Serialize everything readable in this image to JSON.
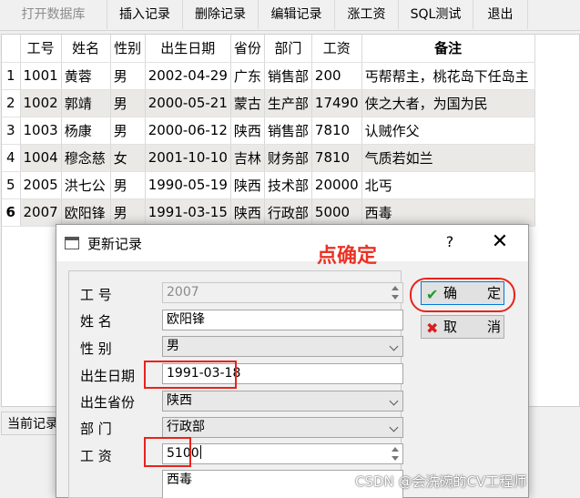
{
  "toolbar": {
    "buttons": [
      {
        "label": "打开数据库",
        "enabled": false
      },
      {
        "label": "插入记录",
        "enabled": true
      },
      {
        "label": "删除记录",
        "enabled": true
      },
      {
        "label": "编辑记录",
        "enabled": true
      },
      {
        "label": "涨工资",
        "enabled": true
      },
      {
        "label": "SQL测试",
        "enabled": true
      },
      {
        "label": "退出",
        "enabled": true
      }
    ]
  },
  "table": {
    "headers": [
      "工号",
      "姓名",
      "性别",
      "出生日期",
      "省份",
      "部门",
      "工资",
      "备注"
    ],
    "rows": [
      {
        "num": "1",
        "cells": [
          "1001",
          "黄蓉",
          "男",
          "2002-04-29",
          "广东",
          "销售部",
          "200",
          "丐帮帮主，桃花岛下任岛主"
        ]
      },
      {
        "num": "2",
        "cells": [
          "1002",
          "郭靖",
          "男",
          "2000-05-21",
          "蒙古",
          "生产部",
          "17490",
          "侠之大者，为国为民"
        ]
      },
      {
        "num": "3",
        "cells": [
          "1003",
          "杨康",
          "男",
          "2000-06-12",
          "陕西",
          "销售部",
          "7810",
          "认贼作父"
        ]
      },
      {
        "num": "4",
        "cells": [
          "1004",
          "穆念慈",
          "女",
          "2001-10-10",
          "吉林",
          "财务部",
          "7810",
          "气质若如兰"
        ]
      },
      {
        "num": "5",
        "cells": [
          "2005",
          "洪七公",
          "男",
          "1990-05-19",
          "陕西",
          "技术部",
          "20000",
          "北丐"
        ]
      },
      {
        "num": "6",
        "cells": [
          "2007",
          "欧阳锋",
          "男",
          "1991-03-15",
          "陕西",
          "行政部",
          "5000",
          "西毒"
        ]
      }
    ],
    "current_row": 6
  },
  "status": {
    "text": "当前记录"
  },
  "dialog": {
    "title": "更新记录",
    "help": "?",
    "close": "✕",
    "annotation": "点确定",
    "fields": {
      "id": {
        "label": "工    号",
        "value": "2007"
      },
      "name": {
        "label": "姓    名",
        "value": "欧阳锋"
      },
      "gender": {
        "label": "性    别",
        "value": "男"
      },
      "birth": {
        "label": "出生日期",
        "value": "1991-03-18"
      },
      "province": {
        "label": "出生省份",
        "value": "陕西"
      },
      "dept": {
        "label": "部    门",
        "value": "行政部"
      },
      "salary": {
        "label": "工    资",
        "value": "5100"
      },
      "note": {
        "value": "西毒"
      }
    },
    "ok": {
      "text1": "确",
      "text2": "定",
      "icon": "✔"
    },
    "cancel": {
      "text1": "取",
      "text2": "消",
      "icon": "✖"
    }
  },
  "watermark": "CSDN @会洗碗的CV工程师",
  "colors": {
    "annotation": "#e8231c",
    "ok_icon": "#1a9e2a",
    "cancel_icon": "#d81e1e"
  }
}
